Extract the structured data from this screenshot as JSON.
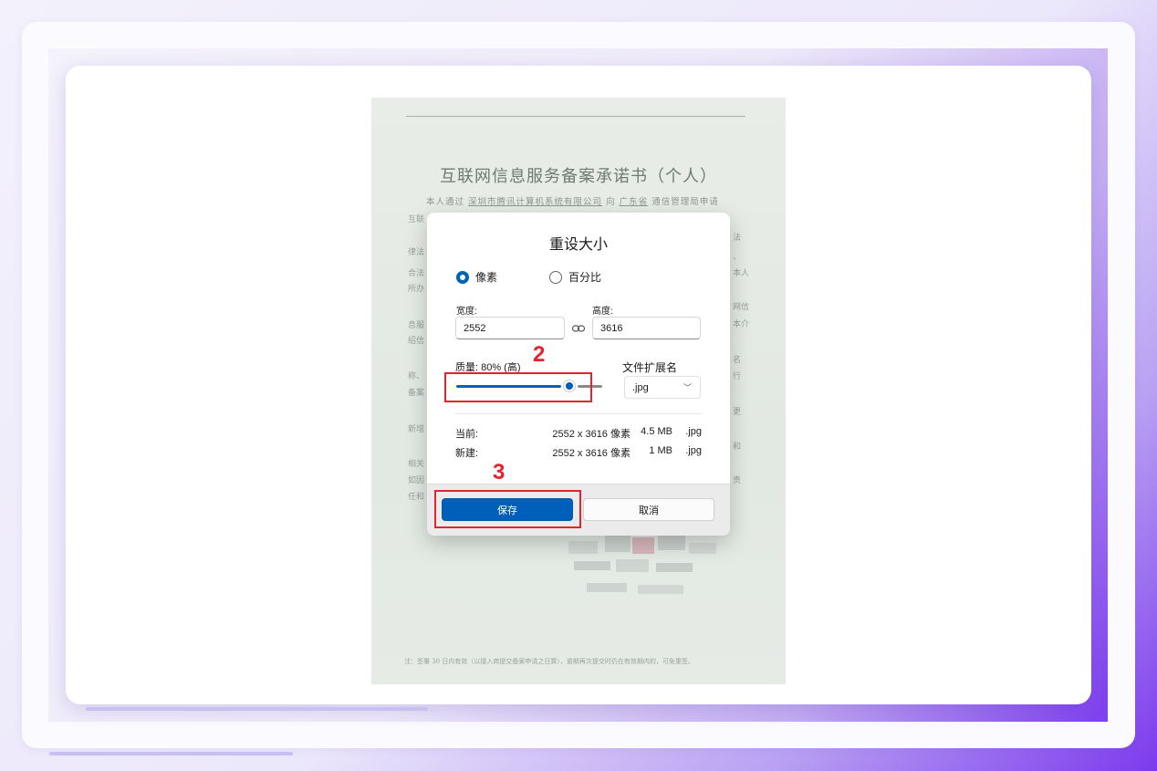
{
  "document": {
    "title": "互联网信息服务备案承诺书（个人）",
    "first_line": {
      "prefix": "本人通过",
      "company": "深圳市腾讯计算机系统有限公司",
      "mid": "向",
      "province": "广东省",
      "suffix": "通信管理局申请"
    },
    "fragments_left": [
      "互联",
      "律法",
      "合法",
      "所办",
      "息服",
      "绍信",
      "称、",
      "备案",
      "新增",
      "相关",
      "如因",
      "任和"
    ],
    "fragments_right": [
      "法",
      "、",
      "本人",
      "网信",
      "本介",
      "名",
      "行",
      "更",
      "和",
      "责"
    ],
    "footer_note": "注：签署 30 日内有效（以接入商提交备案申请之日算），逾期再次提交时仍在有效期内的，可免重签。"
  },
  "dialog": {
    "title": "重设大小",
    "mode_options": [
      {
        "label": "像素",
        "selected": true
      },
      {
        "label": "百分比",
        "selected": false
      }
    ],
    "width_label": "宽度:",
    "width_value": "2552",
    "height_label": "高度:",
    "height_value": "3616",
    "quality_label": "质量: 80% (高)",
    "quality_value": 0.8,
    "extension_label": "文件扩展名",
    "extension_value": ".jpg",
    "current": {
      "label": "当前:",
      "dimensions": "2552 x 3616 像素",
      "size": "4.5 MB",
      "ext": ".jpg"
    },
    "new": {
      "label": "新建:",
      "dimensions": "2552 x 3616 像素",
      "size": "1 MB",
      "ext": ".jpg"
    },
    "save_label": "保存",
    "cancel_label": "取消"
  },
  "annotations": {
    "step2": "2",
    "step3": "3",
    "color": "#e3232f"
  },
  "colors": {
    "accent": "#005fb8",
    "background_gradient_end": "#7c3aed"
  },
  "icons": {
    "link": "link-icon",
    "dropdown": "chevron-down-icon"
  }
}
